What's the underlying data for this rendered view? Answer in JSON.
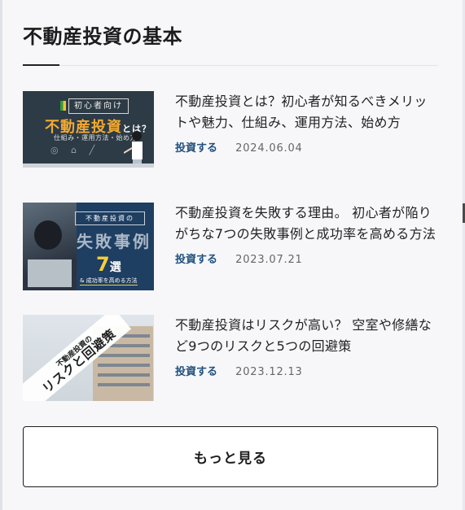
{
  "section": {
    "title": "不動産投資の基本"
  },
  "articles": [
    {
      "title": "不動産投資とは？初心者が知るべきメリットや魅力、仕組み、運用方法、始め方",
      "category": "投資する",
      "date": "2024.06.04",
      "thumb": {
        "tag": "初心者向け",
        "main": "不動産投資",
        "main_suffix": "とは？",
        "sub": "仕組み・運用方法・始め方"
      }
    },
    {
      "title": "不動産投資を失敗する理由。 初心者が陥りがちな7つの失敗事例と成功率を高める方法",
      "category": "投資する",
      "date": "2023.07.21",
      "thumb": {
        "tag": "不動産投資の",
        "big": "失敗事例",
        "num": "7",
        "num_suffix": "選",
        "foot": "& 成功率を高める方法"
      }
    },
    {
      "title": "不動産投資はリスクが高い？ 空室や修繕など9つのリスクと5つの回避策",
      "category": "投資する",
      "date": "2023.12.13",
      "thumb": {
        "small": "不動産投資の",
        "big": "リスクと回避策"
      }
    }
  ],
  "more_button": {
    "label": "もっと見る"
  },
  "colors": {
    "category": "#1f4f7d",
    "accent_orange": "#f3a931",
    "accent_yellow": "#f4cf3a"
  }
}
